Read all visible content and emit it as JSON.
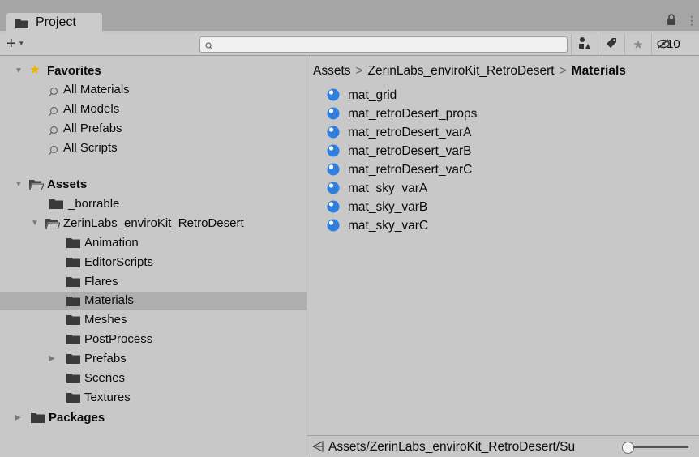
{
  "tab": {
    "title": "Project",
    "icon": "folder-icon"
  },
  "toolbar": {
    "add_label": "+",
    "add_caret": "▾",
    "search_placeholder": "",
    "hidden_packages_count": "10"
  },
  "tree": {
    "favorites": {
      "label": "Favorites",
      "items": [
        "All Materials",
        "All Models",
        "All Prefabs",
        "All Scripts"
      ]
    },
    "assets": {
      "label": "Assets",
      "borrable": "_borrable",
      "kit": "ZerinLabs_enviroKit_RetroDesert",
      "kit_children": [
        "Animation",
        "EditorScripts",
        "Flares",
        "Materials",
        "Meshes",
        "PostProcess",
        "Prefabs",
        "Scenes",
        "Textures"
      ],
      "selected": "Materials"
    },
    "packages": {
      "label": "Packages"
    }
  },
  "breadcrumb": [
    "Assets",
    "ZerinLabs_enviroKit_RetroDesert",
    "Materials"
  ],
  "assets_list": [
    "mat_grid",
    "mat_retroDesert_props",
    "mat_retroDesert_varA",
    "mat_retroDesert_varB",
    "mat_retroDesert_varC",
    "mat_sky_varA",
    "mat_sky_varB",
    "mat_sky_varC"
  ],
  "status": {
    "path": "Assets/ZerinLabs_enviroKit_RetroDesert/Su"
  },
  "colors": {
    "favorite_star": "#f0b400",
    "material_blue": "#2f7fe0",
    "selection": "#aeaeae"
  }
}
